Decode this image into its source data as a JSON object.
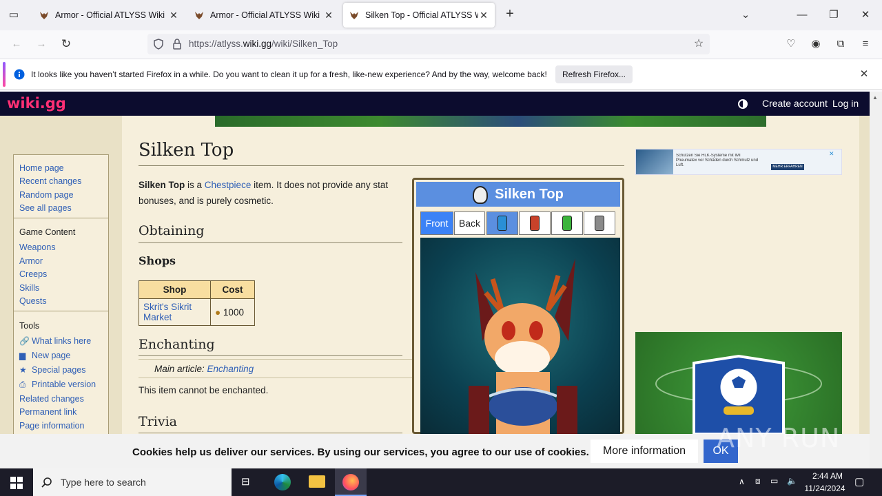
{
  "browser": {
    "tabs": [
      {
        "title": "Armor - Official ATLYSS Wiki",
        "active": false
      },
      {
        "title": "Armor - Official ATLYSS Wiki",
        "active": false
      },
      {
        "title": "Silken Top - Official ATLYSS Wiki",
        "active": true
      }
    ],
    "url_prefix": "https://atlyss.",
    "url_domain": "wiki.gg",
    "url_path": "/wiki/Silken_Top",
    "notification": {
      "message": "It looks like you haven’t started Firefox in a while. Do you want to clean it up for a fresh, like-new experience? And by the way, welcome back!",
      "button": "Refresh Firefox..."
    }
  },
  "wiki": {
    "logo": "wiki.gg",
    "create_account": "Create account",
    "log_in": "Log in"
  },
  "sidebar": {
    "nav": [
      "Home page",
      "Recent changes",
      "Random page",
      "See all pages"
    ],
    "game_content_heading": "Game Content",
    "game_content": [
      "Weapons",
      "Armor",
      "Creeps",
      "Skills",
      "Quests"
    ],
    "tools_heading": "Tools",
    "tools": [
      "What links here",
      "New page",
      "Special pages",
      "Printable version",
      "Related changes",
      "Permanent link",
      "Page information"
    ]
  },
  "article": {
    "title": "Silken Top",
    "intro_bold": "Silken Top",
    "intro_is_a": " is a ",
    "intro_link": "Chestpiece",
    "intro_rest": " item. It does not provide any stat bonuses, and is purely cosmetic.",
    "h_obtaining": "Obtaining",
    "h_shops": "Shops",
    "shop_table": {
      "headers": [
        "Shop",
        "Cost"
      ],
      "rows": [
        {
          "shop": "Skrit's Sikrit Market",
          "cost": "1000"
        }
      ]
    },
    "h_enchanting": "Enchanting",
    "main_article_label": "Main article: ",
    "main_article_link": "Enchanting",
    "enchant_text": "This item cannot be enchanted.",
    "h_trivia": "Trivia"
  },
  "infobox": {
    "title": "Silken Top",
    "buttons": [
      "Front",
      "Back"
    ],
    "dye_colors": [
      "#2a8fd6",
      "#c8422a",
      "#3cb43c",
      "#8a8a8a"
    ]
  },
  "ad1_text": "Schützen Sie HLK-Systeme mit IMI Pneumatex vor Schäden durch Schmutz und Luft.",
  "ad1_button": "MEHR ERFAHREN",
  "cookie": {
    "text": "Cookies help us deliver our services. By using our services, you agree to our use of cookies.",
    "more": "More information",
    "ok": "OK"
  },
  "watermark": "ANY RUN",
  "taskbar": {
    "search_placeholder": "Type here to search",
    "time": "2:44 AM",
    "date": "11/24/2024"
  }
}
